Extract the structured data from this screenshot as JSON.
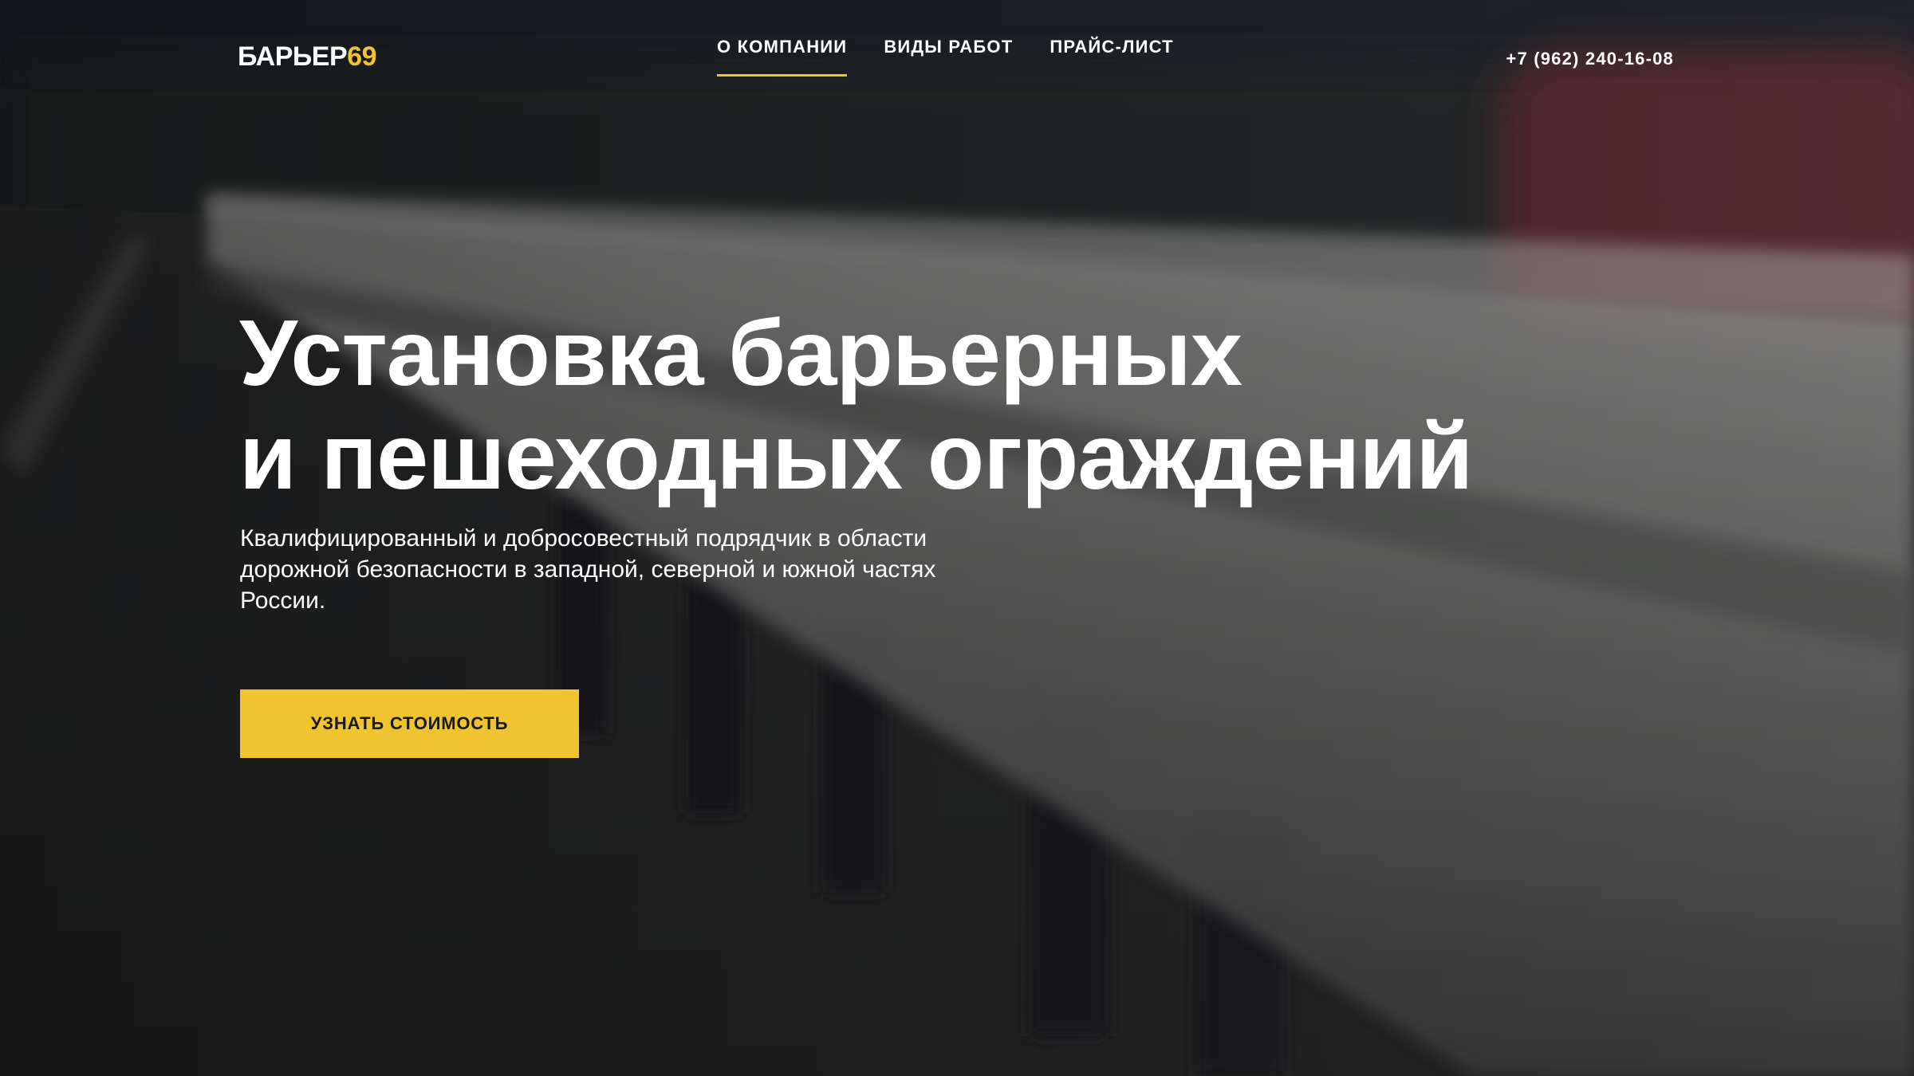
{
  "header": {
    "logo_text": "БАРЬЕР",
    "logo_accent": "69",
    "nav": [
      {
        "label": "О КОМПАНИИ",
        "active": true
      },
      {
        "label": "ВИДЫ РАБОТ",
        "active": false
      },
      {
        "label": "ПРАЙС-ЛИСТ",
        "active": false
      }
    ],
    "phone": "+7 (962) 240-16-08"
  },
  "hero": {
    "title_line1": "Установка барьерных",
    "title_line2": "и пешеходных ограждений",
    "subtitle": "Квалифицированный и добросовестный подрядчик в области дорожной безопасности в западной, северной и южной частях России.",
    "cta_label": "УЗНАТЬ СТОИМОСТЬ",
    "background_image": "blurred-road-guardrail-photo"
  },
  "colors": {
    "accent": "#f0c431",
    "text": "#ffffff",
    "button_text": "#1a1a1a",
    "overlay": "#1b1c1d"
  }
}
